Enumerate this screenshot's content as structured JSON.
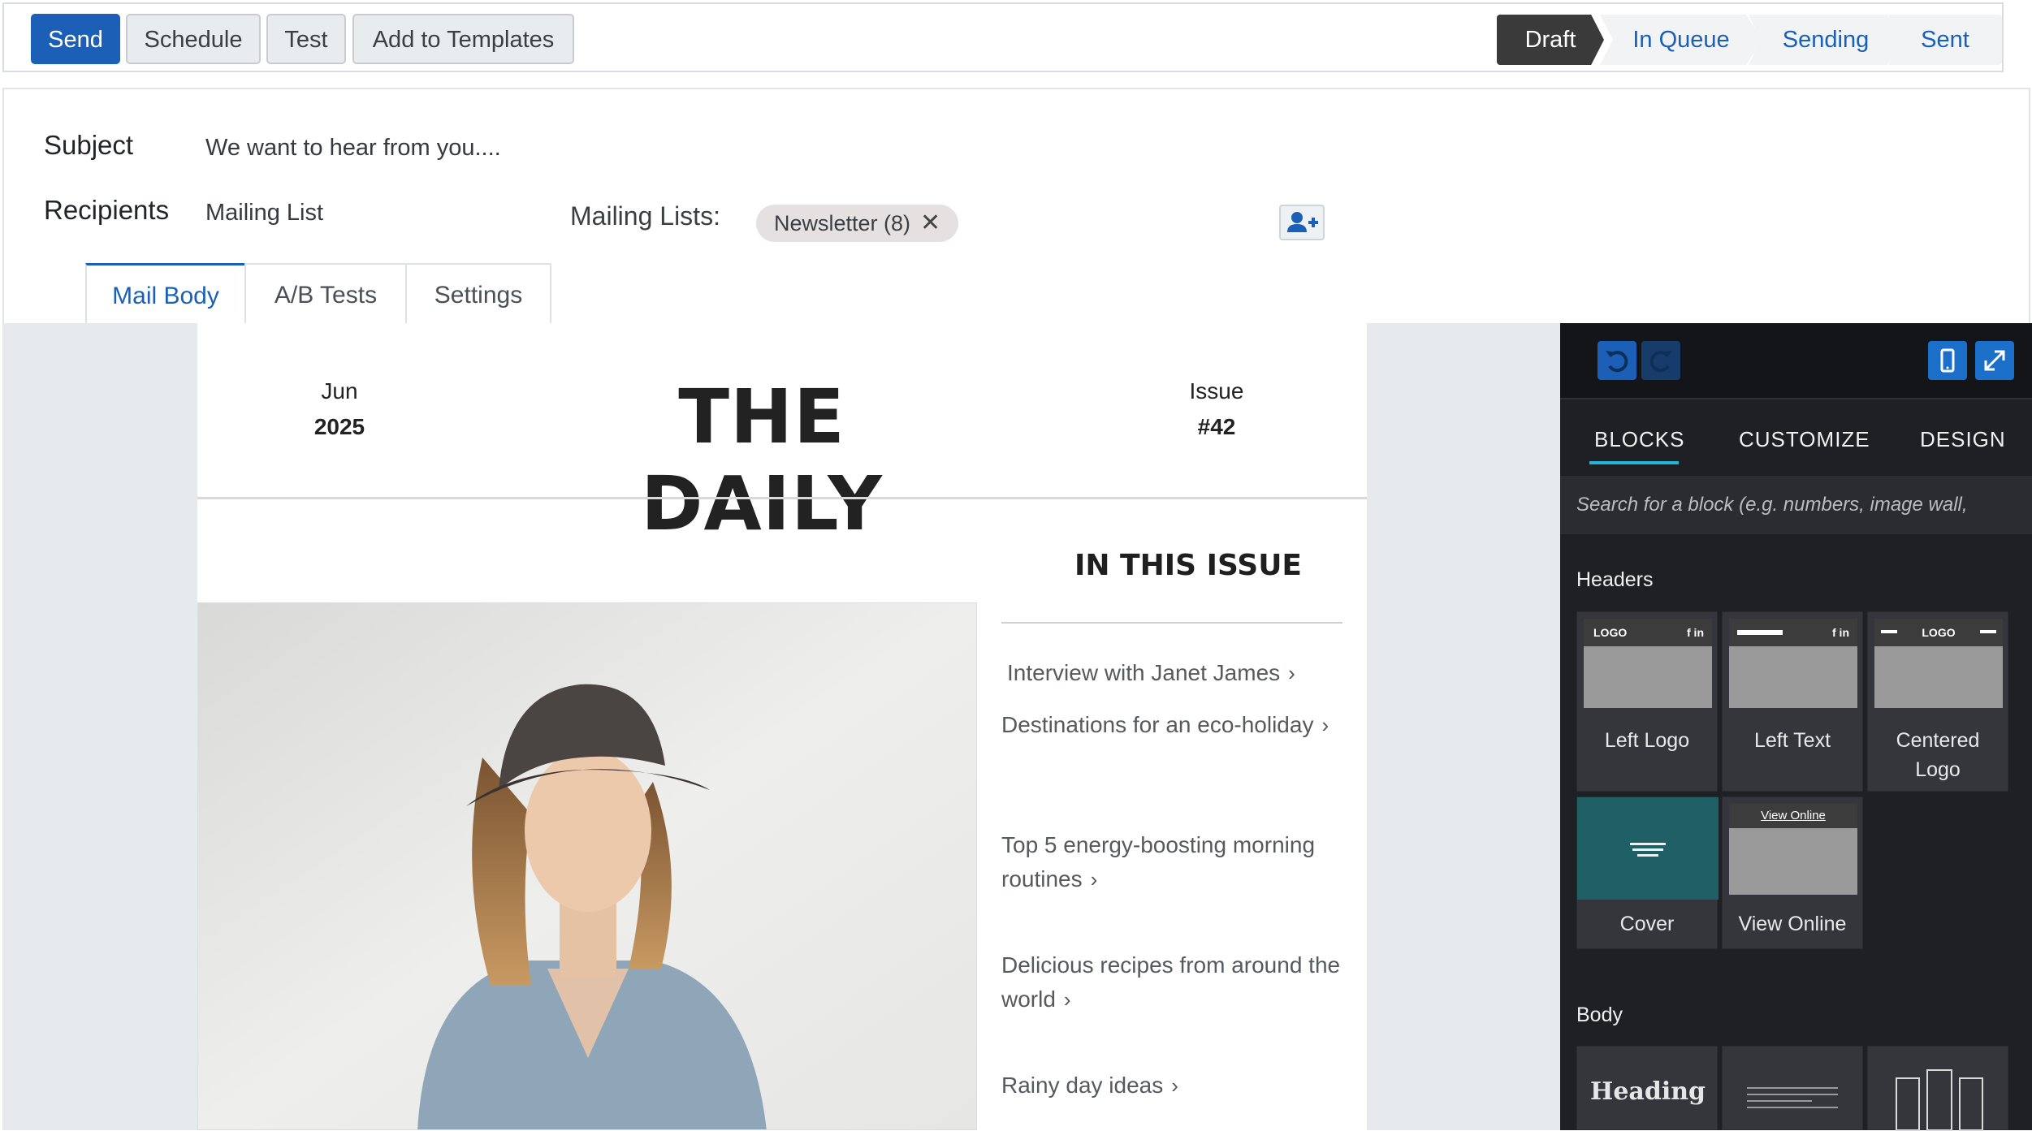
{
  "toolbar": {
    "send": "Send",
    "schedule": "Schedule",
    "test": "Test",
    "add_templates": "Add to Templates"
  },
  "status_stages": [
    "Draft",
    "In Queue",
    "Sending",
    "Sent"
  ],
  "status_active": "Draft",
  "form": {
    "subject_label": "Subject",
    "subject_value": "We want to hear from you....",
    "recipients_label": "Recipients",
    "recipients_value": "Mailing List",
    "mailing_lists_label": "Mailing Lists:",
    "mailing_list_tag": "Newsletter (8)"
  },
  "tabs": [
    "Mail Body",
    "A/B Tests",
    "Settings"
  ],
  "mail": {
    "month": "Jun",
    "year": "2025",
    "title": "THE DAILY",
    "issue_label": "Issue",
    "issue_number": "#42",
    "in_this_issue": "IN THIS ISSUE",
    "articles": [
      "Interview with Janet James",
      "Destinations for an eco-holiday",
      "Top 5 energy-boosting morning routines",
      "Delicious recipes from around the world",
      "Rainy day ideas"
    ]
  },
  "panel": {
    "tabs": [
      "BLOCKS",
      "CUSTOMIZE",
      "DESIGN"
    ],
    "search_placeholder": "Search for a block (e.g. numbers, image wall,",
    "sections": {
      "headers": "Headers",
      "body": "Body"
    },
    "header_blocks": [
      "Left Logo",
      "Left Text",
      "Centered Logo",
      "Cover",
      "View Online"
    ],
    "thumb_texts": {
      "logo": "LOGO",
      "social": "f in ",
      "view_online": "View Online",
      "heading": "Heading"
    }
  },
  "colors": {
    "primary": "#1b5fb7",
    "panel_bg": "#1f2024",
    "accent": "#21b5d8",
    "cover_teal": "#1f5f66"
  }
}
